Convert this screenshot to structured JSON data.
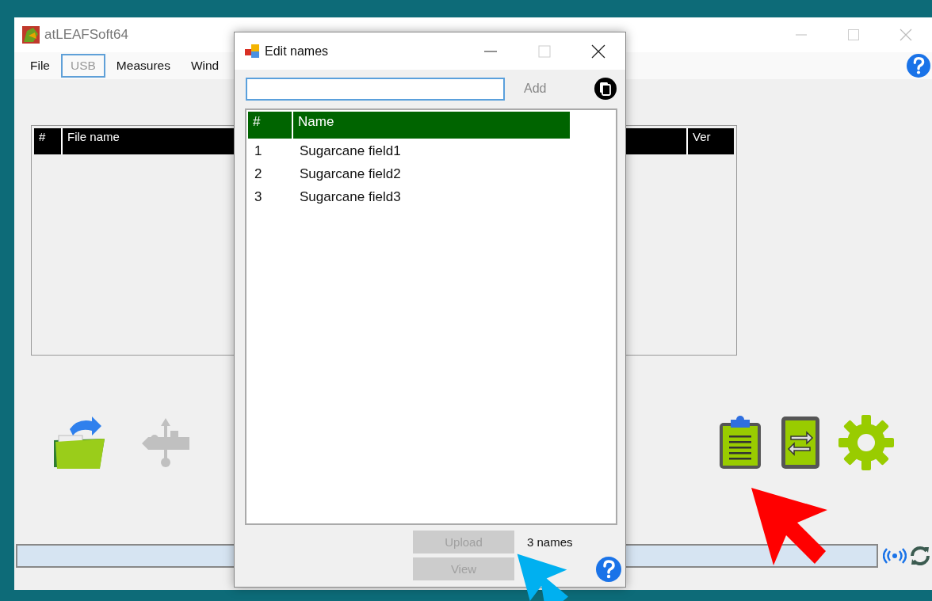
{
  "main_window": {
    "title": "atLEAFSoft64",
    "menu": [
      {
        "label": "File",
        "selected": false,
        "disabled": false
      },
      {
        "label": "USB",
        "selected": true,
        "disabled": true
      },
      {
        "label": "Measures",
        "selected": false,
        "disabled": false
      },
      {
        "label": "Wind",
        "selected": false,
        "disabled": false
      }
    ],
    "table": {
      "columns": [
        "#",
        "File name",
        "Ver"
      ]
    },
    "left_tools": [
      {
        "kind": "open-folder",
        "disabled": false
      },
      {
        "kind": "usb",
        "disabled": true
      }
    ],
    "right_tools": [
      {
        "kind": "clipboard",
        "disabled": false
      },
      {
        "kind": "transfer",
        "disabled": false
      },
      {
        "kind": "settings",
        "disabled": false
      }
    ]
  },
  "dialog": {
    "title": "Edit names",
    "add_button": {
      "label": "Add",
      "disabled": true
    },
    "list": {
      "columns": [
        "#",
        "Name"
      ],
      "rows": [
        {
          "index": "1",
          "name": "Sugarcane field1"
        },
        {
          "index": "2",
          "name": "Sugarcane field2"
        },
        {
          "index": "3",
          "name": "Sugarcane field3"
        }
      ]
    },
    "upload_button": {
      "label": "Upload",
      "disabled": true
    },
    "view_button": {
      "label": "View",
      "disabled": true
    },
    "count": "3 names"
  }
}
